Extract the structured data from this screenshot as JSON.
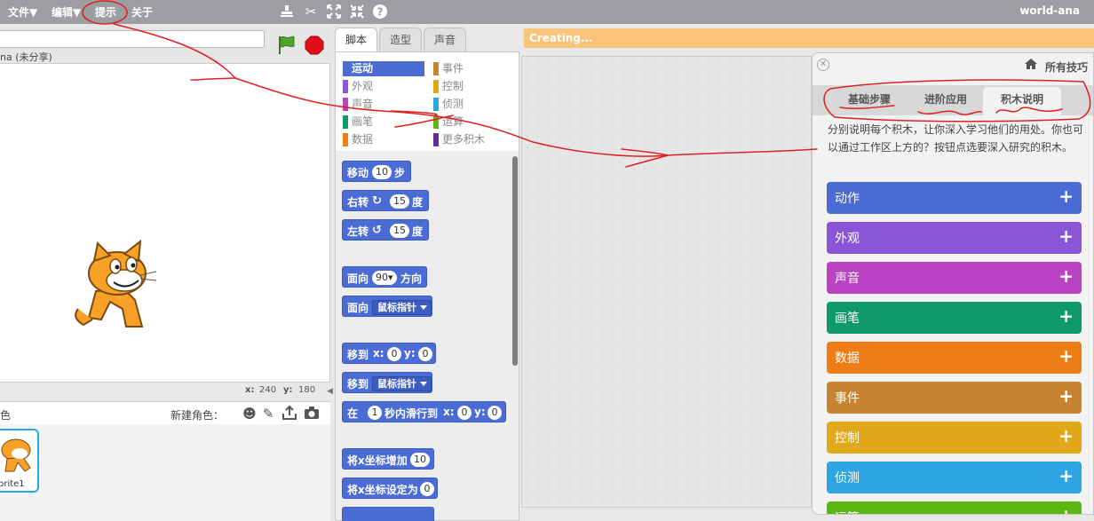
{
  "menu": {
    "file": "文件▼",
    "edit": "编辑▼",
    "tips": "提示",
    "about": "关于",
    "user": "world-ana"
  },
  "toolbar": {
    "duplicate_icon": "stamp-icon",
    "cut_icon": "scissors-icon",
    "grow_icon": "expand-icon",
    "shrink_icon": "shrink-icon",
    "help_icon": "help-icon"
  },
  "stage": {
    "owner": "na (未分享)",
    "x_label": "x:",
    "x_value": "240",
    "y_label": "y:",
    "y_value": "180"
  },
  "sprites": {
    "header": "色",
    "new_sprite": "新建角色：",
    "thumb_name": "prite1"
  },
  "editor_tabs": [
    "脚本",
    "造型",
    "声音"
  ],
  "categories": {
    "left": [
      "运动",
      "外观",
      "声音",
      "画笔",
      "数据"
    ],
    "right": [
      "事件",
      "控制",
      "侦测",
      "运算",
      "更多积木"
    ]
  },
  "blocks": {
    "move": "移动",
    "move_n": "10",
    "move_unit": "步",
    "turn_right": "右转",
    "turn_right_n": "15",
    "turn_unit": "度",
    "turn_left": "左转",
    "turn_left_n": "15",
    "point_dir": "面向",
    "point_dir_v": "90▾",
    "point_dir_unit": "方向",
    "point_towards": "面向",
    "point_towards_v": "鼠标指针",
    "goto_xy": "移到",
    "x": "x:",
    "x_v": "0",
    "y": "y:",
    "y_v": "0",
    "goto": "移到",
    "goto_v": "鼠标指针",
    "glide": "在",
    "glide_secs": "1",
    "glide_mid": "秒内滑行到",
    "change_x": "将x坐标增加",
    "change_x_v": "10",
    "set_x": "将x坐标设定为",
    "set_x_v": "0"
  },
  "status": "Creating...",
  "tips": {
    "all_tips": "所有技巧",
    "tabs": [
      "基础步骤",
      "进阶应用",
      "积木说明"
    ],
    "description": "分别说明每个积木，让你深入学习他们的用处。你也可以通过工作区上方的？按钮点选要深入研究的积木。",
    "plus": "+",
    "categories": [
      "动作",
      "外观",
      "声音",
      "画笔",
      "数据",
      "事件",
      "控制",
      "侦测",
      "运算"
    ]
  },
  "colors": {
    "motion": "#4a6cd4",
    "looks": "#8a55d7",
    "sound": "#bb42c3",
    "pen": "#0e9a6c",
    "data": "#ee7d16",
    "events": "#c88330",
    "control": "#e1a91a",
    "sensing": "#2ca5e2",
    "operators": "#5cb712",
    "more": "#632d99",
    "annotation": "#e02020"
  }
}
